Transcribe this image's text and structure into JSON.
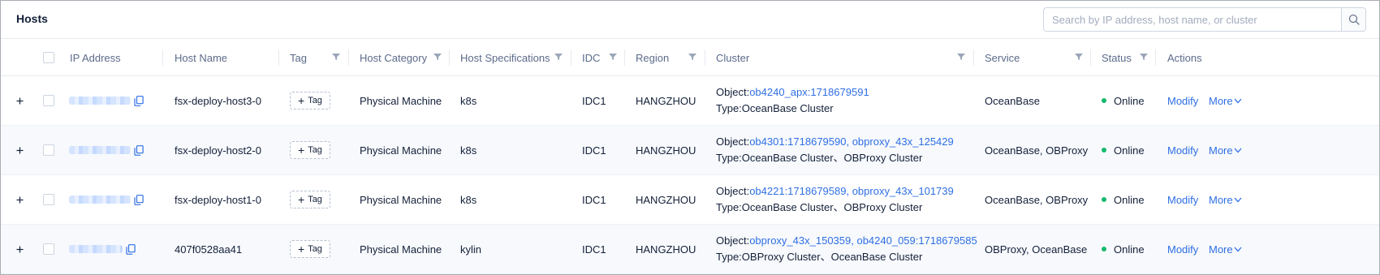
{
  "page": {
    "title": "Hosts"
  },
  "search": {
    "placeholder": "Search by IP address, host name, or cluster"
  },
  "columns": {
    "ip": "IP Address",
    "host_name": "Host Name",
    "tag": "Tag",
    "category": "Host Category",
    "specs": "Host Specifications",
    "idc": "IDC",
    "region": "Region",
    "cluster": "Cluster",
    "service": "Service",
    "status": "Status",
    "actions": "Actions"
  },
  "icons": {
    "search": "search-icon",
    "filter": "filter-icon",
    "expand": "plus-icon",
    "copy": "copy-icon",
    "more": "chevron-down-icon"
  },
  "colors": {
    "link": "#2f6fe4",
    "online": "#13b96e"
  },
  "rows": [
    {
      "host_name": "fsx-deploy-host3-0",
      "tag_label": "Tag",
      "category": "Physical Machine",
      "specs": "k8s",
      "idc": "IDC1",
      "region": "HANGZHOU",
      "object_prefix": "Object:",
      "object_value": "ob4240_apx:1718679591",
      "type_text": "Type:OceanBase Cluster",
      "service": "OceanBase",
      "status": "Online",
      "modify": "Modify",
      "more": "More"
    },
    {
      "host_name": "fsx-deploy-host2-0",
      "tag_label": "Tag",
      "category": "Physical Machine",
      "specs": "k8s",
      "idc": "IDC1",
      "region": "HANGZHOU",
      "object_prefix": "Object:",
      "object_value": "ob4301:1718679590, obproxy_43x_125429",
      "type_text": "Type:OceanBase Cluster、OBProxy Cluster",
      "service": "OceanBase, OBProxy",
      "status": "Online",
      "modify": "Modify",
      "more": "More"
    },
    {
      "host_name": "fsx-deploy-host1-0",
      "tag_label": "Tag",
      "category": "Physical Machine",
      "specs": "k8s",
      "idc": "IDC1",
      "region": "HANGZHOU",
      "object_prefix": "Object:",
      "object_value": "ob4221:1718679589, obproxy_43x_101739",
      "type_text": "Type:OceanBase Cluster、OBProxy Cluster",
      "service": "OceanBase, OBProxy",
      "status": "Online",
      "modify": "Modify",
      "more": "More"
    },
    {
      "host_name": "407f0528aa41",
      "tag_label": "Tag",
      "category": "Physical Machine",
      "specs": "kylin",
      "idc": "IDC1",
      "region": "HANGZHOU",
      "object_prefix": "Object:",
      "object_value": "obproxy_43x_150359, ob4240_059:1718679585",
      "type_text": "Type:OBProxy Cluster、OceanBase Cluster",
      "service": "OBProxy, OceanBase",
      "status": "Online",
      "modify": "Modify",
      "more": "More"
    }
  ]
}
